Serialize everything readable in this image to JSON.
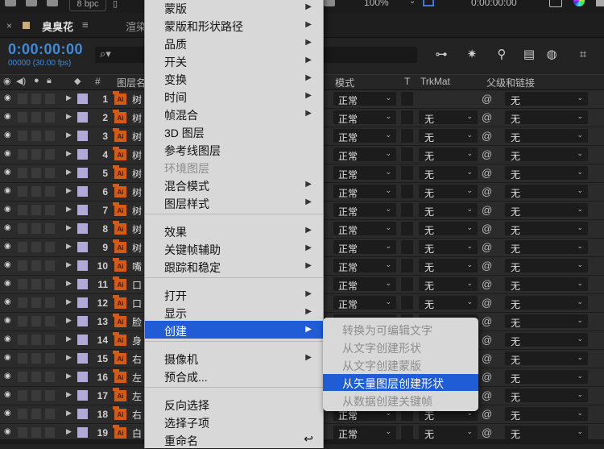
{
  "topbar": {
    "bpc": "8 bpc",
    "zoom": "100%",
    "timecode": "0:00:00:00"
  },
  "tab": {
    "close": "×",
    "name": "臭臭花",
    "menu": "≡",
    "next": "渲染"
  },
  "header": {
    "timecode": "0:00:00:00",
    "fps": "00000 (30.00 fps)"
  },
  "columns": {
    "layer_name": "图层名称",
    "num": "#",
    "mode": "模式",
    "t": "T",
    "trkmat": "TrkMat",
    "parent": "父级和链接"
  },
  "rows": [
    {
      "num": "1",
      "name": "树",
      "mode": "正常",
      "trk": "",
      "parent": "无"
    },
    {
      "num": "2",
      "name": "树",
      "mode": "正常",
      "trk": "无",
      "parent": "无"
    },
    {
      "num": "3",
      "name": "树",
      "mode": "正常",
      "trk": "无",
      "parent": "无"
    },
    {
      "num": "4",
      "name": "树",
      "mode": "正常",
      "trk": "无",
      "parent": "无"
    },
    {
      "num": "5",
      "name": "树",
      "mode": "正常",
      "trk": "无",
      "parent": "无"
    },
    {
      "num": "6",
      "name": "树",
      "mode": "正常",
      "trk": "无",
      "parent": "无"
    },
    {
      "num": "7",
      "name": "树",
      "mode": "正常",
      "trk": "无",
      "parent": "无"
    },
    {
      "num": "8",
      "name": "树",
      "mode": "正常",
      "trk": "无",
      "parent": "无"
    },
    {
      "num": "9",
      "name": "树",
      "mode": "正常",
      "trk": "无",
      "parent": "无"
    },
    {
      "num": "10",
      "name": "嘴",
      "mode": "正常",
      "trk": "无",
      "parent": "无"
    },
    {
      "num": "11",
      "name": "口",
      "mode": "正常",
      "trk": "无",
      "parent": "无"
    },
    {
      "num": "12",
      "name": "口",
      "mode": "正常",
      "trk": "无",
      "parent": "无"
    },
    {
      "num": "13",
      "name": "脸",
      "mode": "正常",
      "trk": "无",
      "parent": "无"
    },
    {
      "num": "14",
      "name": "身",
      "mode": "正常",
      "trk": "无",
      "parent": "无"
    },
    {
      "num": "15",
      "name": "右",
      "mode": "正常",
      "trk": "无",
      "parent": "无"
    },
    {
      "num": "16",
      "name": "左",
      "mode": "正常",
      "trk": "无",
      "parent": "无"
    },
    {
      "num": "17",
      "name": "左",
      "mode": "正常",
      "trk": "无",
      "parent": "无"
    },
    {
      "num": "18",
      "name": "右",
      "mode": "正常",
      "trk": "无",
      "parent": "无"
    },
    {
      "num": "19",
      "name": "白",
      "mode": "正常",
      "trk": "无",
      "parent": "无"
    }
  ],
  "context_menu": {
    "items": [
      {
        "label": "蒙版",
        "arrow": "▶"
      },
      {
        "label": "蒙版和形状路径",
        "arrow": "▶"
      },
      {
        "label": "品质",
        "arrow": "▶"
      },
      {
        "label": "开关",
        "arrow": "▶"
      },
      {
        "label": "变换",
        "arrow": "▶"
      },
      {
        "label": "时间",
        "arrow": "▶"
      },
      {
        "label": "帧混合",
        "arrow": "▶"
      },
      {
        "label": "3D 图层",
        "arrow": ""
      },
      {
        "label": "参考线图层",
        "arrow": ""
      },
      {
        "label": "环境图层",
        "arrow": ""
      },
      {
        "label": "混合模式",
        "arrow": "▶"
      },
      {
        "label": "图层样式",
        "arrow": "▶"
      },
      {
        "label": "效果",
        "arrow": "▶"
      },
      {
        "label": "关键帧辅助",
        "arrow": "▶"
      },
      {
        "label": "跟踪和稳定",
        "arrow": "▶"
      },
      {
        "label": "打开",
        "arrow": "▶"
      },
      {
        "label": "显示",
        "arrow": "▶"
      },
      {
        "label": "创建",
        "arrow": "▶"
      },
      {
        "label": "摄像机",
        "arrow": "▶"
      },
      {
        "label": "预合成...",
        "arrow": ""
      },
      {
        "label": "反向选择",
        "arrow": ""
      },
      {
        "label": "选择子项",
        "arrow": ""
      },
      {
        "label": "重命名",
        "shortcut": "↩"
      }
    ]
  },
  "submenu": {
    "items": [
      {
        "label": "转换为可编辑文字"
      },
      {
        "label": "从文字创建形状"
      },
      {
        "label": "从文字创建蒙版"
      },
      {
        "label": "从矢量图层创建形状"
      },
      {
        "label": "从数据创建关键帧"
      }
    ]
  }
}
